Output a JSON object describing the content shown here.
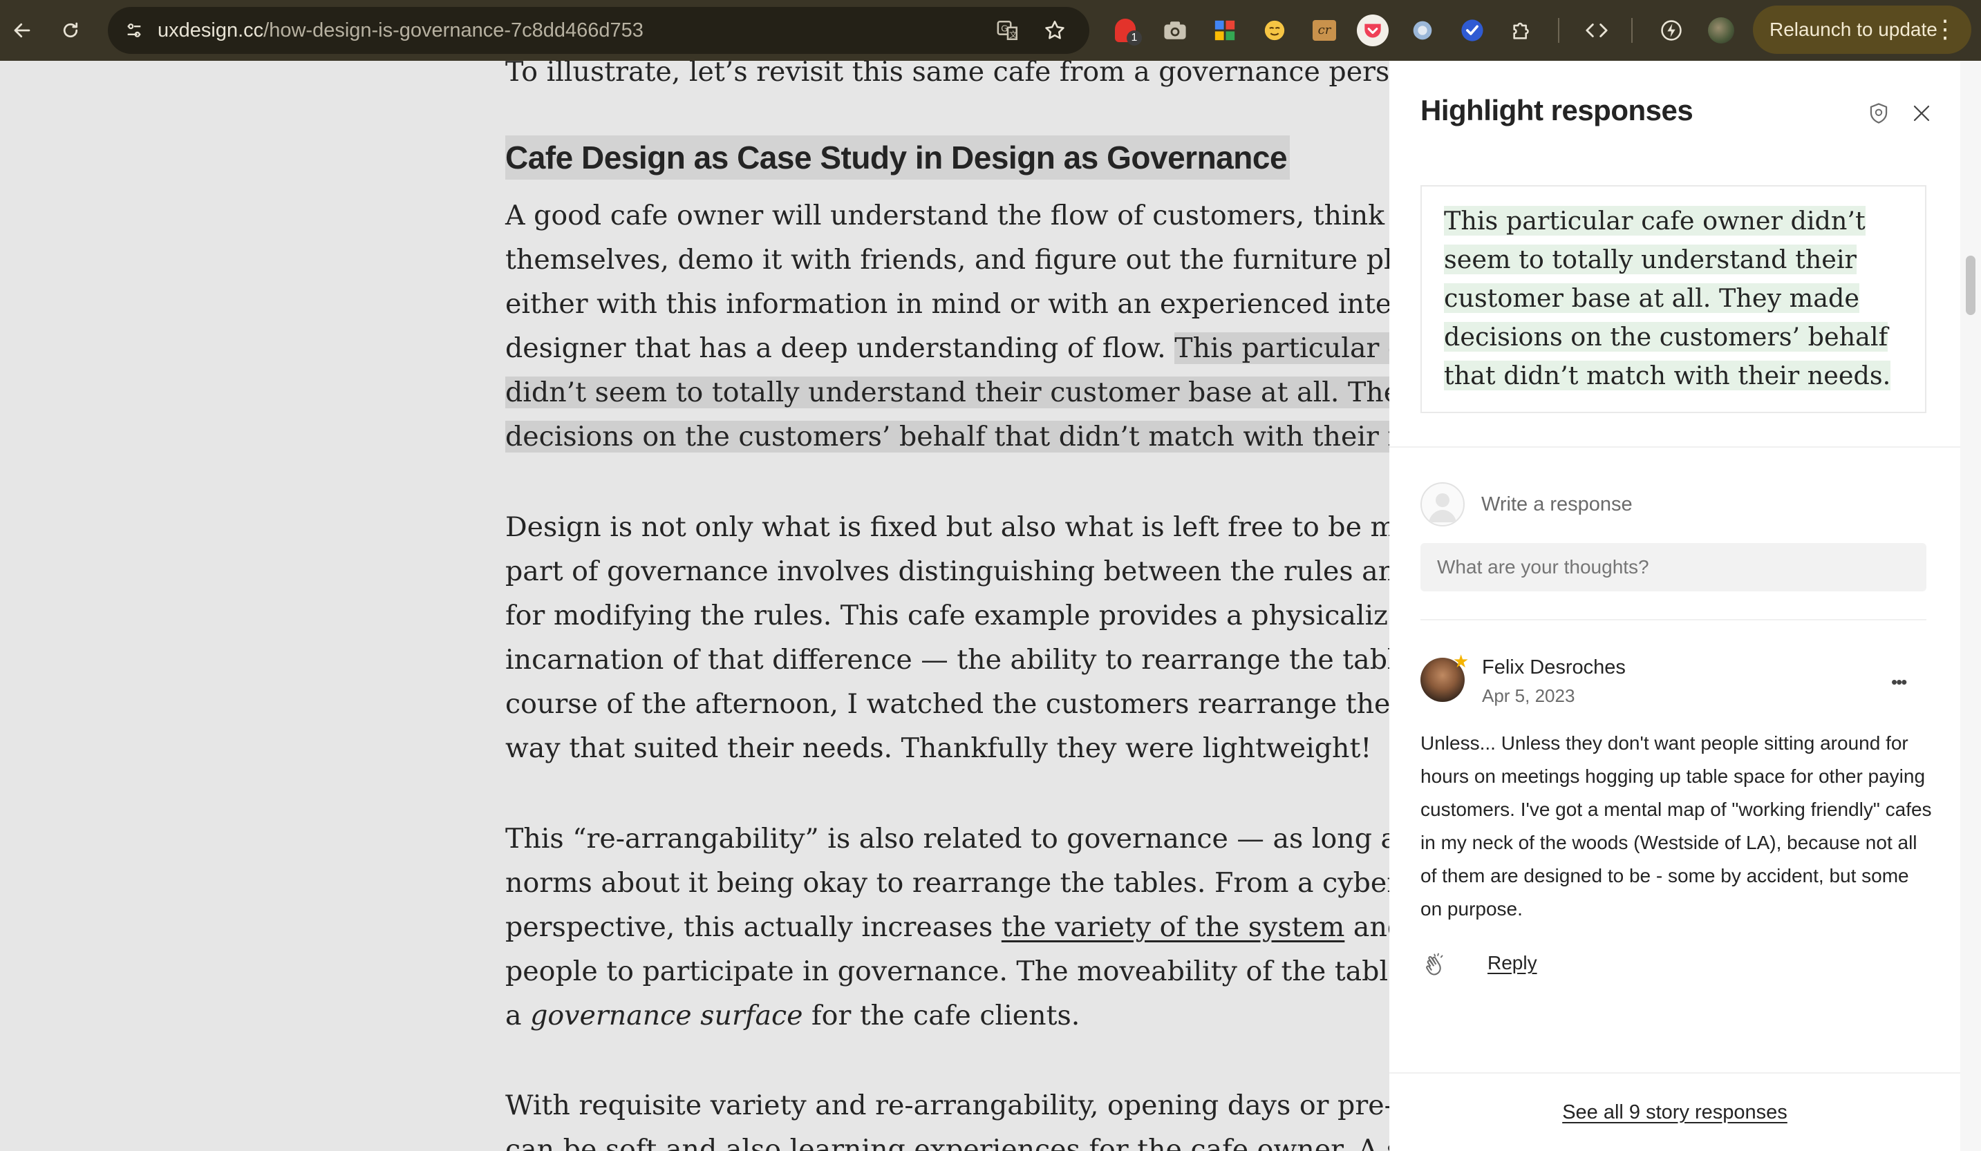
{
  "browser": {
    "url_host": "uxdesign.cc",
    "url_path": "/how-design-is-governance-7c8dd466d753",
    "extension_badge": "1",
    "relaunch_label": "Relaunch to update",
    "more_glyph": "⋮"
  },
  "article": {
    "top_line": "To illustrate, let’s revisit this same cafe from a governance perspective.",
    "heading": "Cafe Design as Case Study in Design as Governance",
    "para1": {
      "l1": "A good cafe owner will understand the flow of customers, think it through",
      "l2": "themselves, demo it with friends, and figure out the furniture placement",
      "l3": "either with this information in mind or with an experienced interior",
      "l4_plain": "designer that has a deep understanding of flow. ",
      "l4_hl": "This particular cafe owner",
      "l5_hl": "didn’t seem to totally understand their customer base at all. They made",
      "l6_hl": "decisions on the customers’ behalf that didn’t match with their needs."
    },
    "para2": {
      "l1": "Design is not only what is fixed but also what is left free to be modified. A",
      "l2": "part of governance involves distinguishing between the rules and the rules",
      "l3": "for modifying the rules. This cafe example provides a physicalized",
      "l4": "incarnation of that difference — the ability to rearrange the tables! Over the",
      "l5": "course of the afternoon, I watched the customers rearrange the tables in a",
      "l6": "way that suited their needs. Thankfully they were lightweight!"
    },
    "para3": {
      "l1": "This “re-arrangability” is also related to governance — as long as there are",
      "l2": "norms about it being okay to rearrange the tables. From a cybernetics",
      "l3_a": "perspective, this actually increases ",
      "l3_link": "the variety of the system",
      "l3_b": " and empowers",
      "l4": "people to participate in governance. The moveability of the tables introduces",
      "l5_a": "a ",
      "l5_em": "governance surface",
      "l5_b": " for the cafe clients."
    },
    "para4": {
      "l1": "With requisite variety and re-arrangability, opening days or pre-openings",
      "l2": "can be soft and also learning experiences for the cafe owner. A soft launch"
    }
  },
  "panel": {
    "title": "Highlight responses",
    "quote": "This particular cafe owner didn’t seem to totally understand their customer base at all. They made decisions on the customers’ behalf that didn’t match with their needs.",
    "write_label": "Write a response",
    "input_placeholder": "What are your thoughts?",
    "comment": {
      "author": "Felix Desroches",
      "date": "Apr 5, 2023",
      "body": "Unless... Unless they don't want people sitting around for hours on meetings hogging up table space for other paying customers. I've got a mental map of \"working friendly\" cafes in my neck of the woods (Westside of LA), because not all of them are designed to be - some by accident, but some on purpose.",
      "reply_label": "Reply",
      "more_glyph": "•••"
    },
    "see_all": "See all 9 story responses"
  },
  "colors": {
    "toolbar_bg": "#3a3526",
    "omnibox_bg": "#242117",
    "relaunch_bg": "#5a4b1f",
    "article_bg": "#e6e6e6",
    "highlight": "#cfcfcf",
    "quote_highlight": "#e6f2e7",
    "text": "#242424"
  }
}
